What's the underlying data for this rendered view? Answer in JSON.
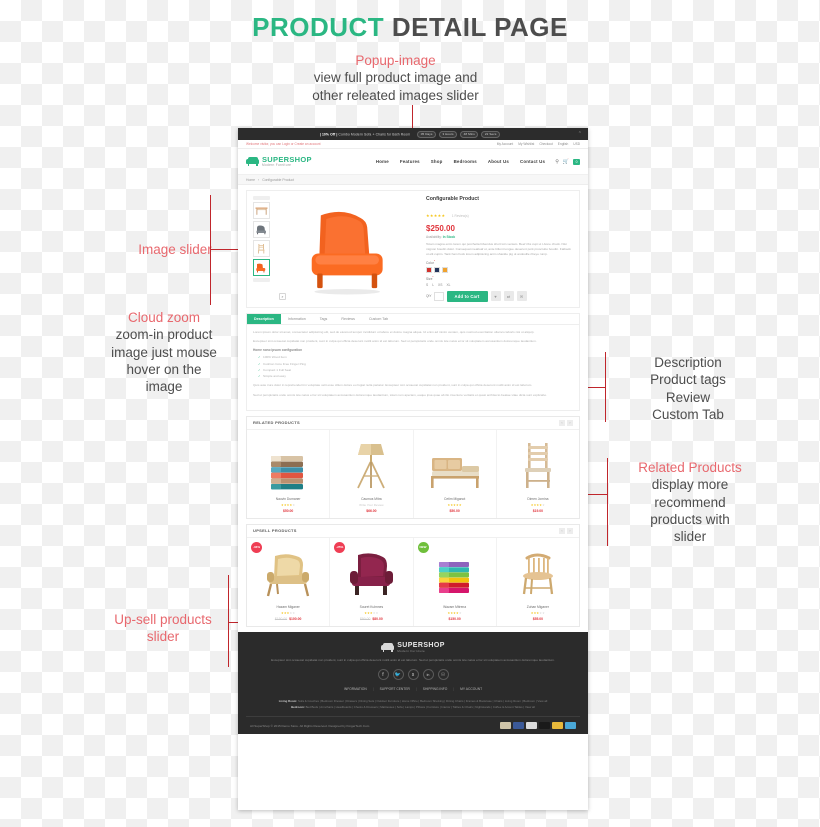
{
  "page": {
    "title_green": "PRODUCT",
    "title_dark": "DETAIL PAGE"
  },
  "annotations": {
    "popup_image": {
      "head": "Popup-image",
      "line1": "view full product image  and",
      "line2": "other releated images slider"
    },
    "image_slider": {
      "head": "Image slider"
    },
    "cloud_zoom": {
      "head": "Cloud zoom",
      "line1": "zoom-in product",
      "line2": "image just mouse",
      "line3": "hover on the",
      "line4": "image"
    },
    "tabs_note": {
      "line1": "Description",
      "line2": "Product tags",
      "line3": "Review",
      "line4": "Custom Tab"
    },
    "related_note": {
      "head": "Related Products",
      "line1": "display more",
      "line2": "recommend",
      "line3": "products with",
      "line4": "slider"
    },
    "upsell_note": {
      "head": "Up-sell products",
      "line2": "slider"
    }
  },
  "site": {
    "promo": {
      "prefix": "| 10% Off |",
      "text": "Combo Modern Sofa + Chairs for Bath Room",
      "chips": [
        "05 Days",
        "3 Hours",
        "48 Mins",
        "22 Secs"
      ],
      "caret": "⌃"
    },
    "welcome": {
      "left": "Welcome visitor, you can Login or Create an account",
      "links": [
        "My Account",
        "My Wishlist",
        "Checkout",
        "English",
        "USD"
      ]
    },
    "logo": {
      "name": "SUPERSHOP",
      "tagline": "Modern Furniture"
    },
    "menu": [
      "Home",
      "Features",
      "Shop",
      "Bedrooms",
      "About Us",
      "Contact Us"
    ],
    "nav_icons": {
      "search": "⌕",
      "cart": "Ὥ2",
      "count": "0"
    },
    "breadcrumb": [
      "Home",
      "›",
      "Configurable Product"
    ]
  },
  "product": {
    "name": "Configurable Product",
    "stars_filled": 5,
    "review_text": "1 Review(s)",
    "price": "$250.00",
    "availability_label": "Availability:",
    "availability_value": "In Stock",
    "description": "Totam magna enim lorem qui porchetta bibendus short loin veniam. Beef ribs cupi ut t-bone chuck. Nisi mignon boudin dolor. Consequat meatloaf ut, ante biltont tongue deserunt pork prosciutto boudin. Fatback ut elit cupim. Tank ham hock lorem adipisicing anim shankle pig ut andouille ribeye rump.",
    "color_label": "Color",
    "colors": [
      "#d2322d",
      "#24355c",
      "#f0a22e"
    ],
    "size_label": "Size",
    "sizes": [
      "S",
      "L",
      "XS",
      "XL"
    ],
    "qty_label": "QtY",
    "add_to_cart": "Add to Cart",
    "action_icons": [
      "♥",
      "⇄",
      "✉"
    ],
    "zoom_icon": "⌕"
  },
  "tabs": {
    "items": [
      "Description",
      "Information",
      "Tags",
      "Reviews",
      "Custom Tab"
    ],
    "active": 0,
    "body": {
      "p1": "Lorem ipsum dolor sit amet, consectetur adipisicing elit, sed do eiusmod tempor incididunt ut labore et dolore magna aliqua. Ut enim ad minim veniam, quis nostrud exercitation ullamco laboris nisi ut aliquip.",
      "p2": "Exceptuer sint occaecat cupidatat non proident, sunt in culpa qui officia deserunt mollit anim id est laborum. Sed ut perspiciatis unde omnis iste natus error sit voluptatem accusantium doloremque laudantium.",
      "features_title": "Home nono ipsum configuration",
      "features": [
        "100% Wood Item",
        "Cushion Core Free Finger Ping",
        "Compact 1 Full Seat",
        "Simple and easy"
      ],
      "p3": "Quis aute irure dolor in reprehenderit in voluptate velit esse cillum dolore eu fugiat nulla pariatur. Excepteur sint occaecat cupidatat non proident, sunt in culpa qui officia deserunt mollit anim id est laborum.",
      "p4": "Sed ut perspiciatis unde omnis iste natus error sit voluptatem accusantium doloremque laudantium, totam rem aperiam, eaque ipsa quae ab illo inventore veritatis et quasi architecto beatae vitae dicta sunt explicabo."
    }
  },
  "related": {
    "title": "RELATED PRODUCTS",
    "prev": "‹",
    "next": "›",
    "items": [
      {
        "name": "Nauvin Dumaner",
        "stars": 4,
        "price": "$50.00",
        "icon": "towels",
        "review": ""
      },
      {
        "name": "Caumus Mitra",
        "stars": 0,
        "price": "$66.00",
        "icon": "lamp",
        "review": "Write Your Review"
      },
      {
        "name": "Cetim Miganot",
        "stars": 5,
        "price": "$50.00",
        "icon": "bed",
        "review": ""
      },
      {
        "name": "Dimen Jomina",
        "stars": 4,
        "price": "$19.00",
        "icon": "chair",
        "review": ""
      }
    ]
  },
  "upsell": {
    "title": "UPSELL PRODUCTS",
    "prev": "‹",
    "next": "›",
    "items": [
      {
        "name": "Hazam Miganer",
        "stars": 3,
        "price": "$100.00",
        "old_price": "$150.00",
        "icon": "gold-armchair",
        "badge": "-33%",
        "badge_type": "sale"
      },
      {
        "name": "Souret Kulmnes",
        "stars": 3,
        "price": "$80.00",
        "old_price": "$90.00",
        "icon": "purple-armchair",
        "badge": "-25%",
        "badge_type": "sale"
      },
      {
        "name": "Wazam Mitrena",
        "stars": 4,
        "price": "$150.00",
        "old_price": "",
        "icon": "color-towels",
        "badge": "NEW",
        "badge_type": "new"
      },
      {
        "name": "Zuhan Miganer",
        "stars": 3,
        "price": "$55.00",
        "old_price": "",
        "icon": "wood-chair",
        "badge": "",
        "badge_type": ""
      }
    ]
  },
  "footer": {
    "logo": {
      "name": "SUPERSHOP",
      "tagline": "Modern Furniture"
    },
    "text_line1": "Excepteur sint occaecat cupidatat non proident, sunt in culpa qui officia deserunt mollit anim id est laborum. Sed ut",
    "text_line2": "perspiciatis unde omnis iste natus error sit voluptatem accusantium doloremque laudantium.",
    "socials": [
      "facebook-icon",
      "twitter-icon",
      "skype-icon",
      "linkedin-icon",
      "pinterest-icon"
    ],
    "social_glyphs": [
      "f",
      "ᵗ",
      "s",
      "in",
      "p"
    ],
    "links": [
      "INFORMATION",
      "SUPPORT CENTER",
      "SHIPPING INFO",
      "MY ACCOUNT"
    ],
    "cats": [
      {
        "label": "Living Room:",
        "items": "Sofa & Couches | Bedroom Dresser | Drawers | Dining Sets | Outdoor Furniture | Home Office | Bedroom Shelving | Dining Chairs | Frames & Bookcase | Chairs | Living Room | Bedroom | View all"
      },
      {
        "label": "Bedroom:",
        "items": "Bed Beds | Armchairs | Headboards | Chests & Dressers | Mattresses | Sofa | Lamps | Pillows | Furniture | Interior | Tables & Chairs | Nightstands | Coffee & Accent Tables | View all"
      }
    ],
    "copyright": "All SuperShop © 2015 Demo Store. All Rights Reserved. Designed by KingerTech.Com",
    "cards": [
      "#cfc4a8",
      "#3b5998",
      "#dcdcdc",
      "#1a1a1a",
      "#e8b93b",
      "#4aa8d8"
    ]
  }
}
